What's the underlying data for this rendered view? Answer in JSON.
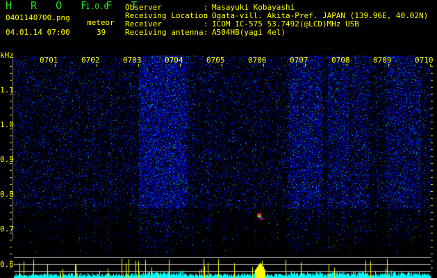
{
  "header": {
    "app_title": "H R O F F T",
    "version": "1.0.0",
    "filename": "0401140700.png",
    "datetime": "04.01.14 07:00",
    "meteor_label": "meteor",
    "meteor_count": "39"
  },
  "info": [
    {
      "label": "Observer",
      "value": "Masayuki Kobayashi"
    },
    {
      "label": "Receiving Location",
      "value": "Ogata-vill. Akita-Pref. JAPAN (139.96E, 40.02N)"
    },
    {
      "label": "Receiver",
      "value": "ICOM IC-575 53.7492(@LCD)MHz USB"
    },
    {
      "label": "Receiving antenna",
      "value": "A504HB(yagi 4el)"
    }
  ],
  "spectrogram": {
    "y_unit": "kHz",
    "y_ticks": [
      "1.1",
      "1.0",
      "0.9",
      "0.8",
      "0.7",
      "0.6"
    ],
    "x_ticks": [
      "0701",
      "0702",
      "0703",
      "0704",
      "0705",
      "0706",
      "0707",
      "0708",
      "0709",
      "0710"
    ],
    "colors": {
      "text": "#ffff00",
      "title": "#22dd22",
      "activity": "#00ffff",
      "echo": "#ffff00",
      "grid": "#aaaaaa"
    }
  }
}
